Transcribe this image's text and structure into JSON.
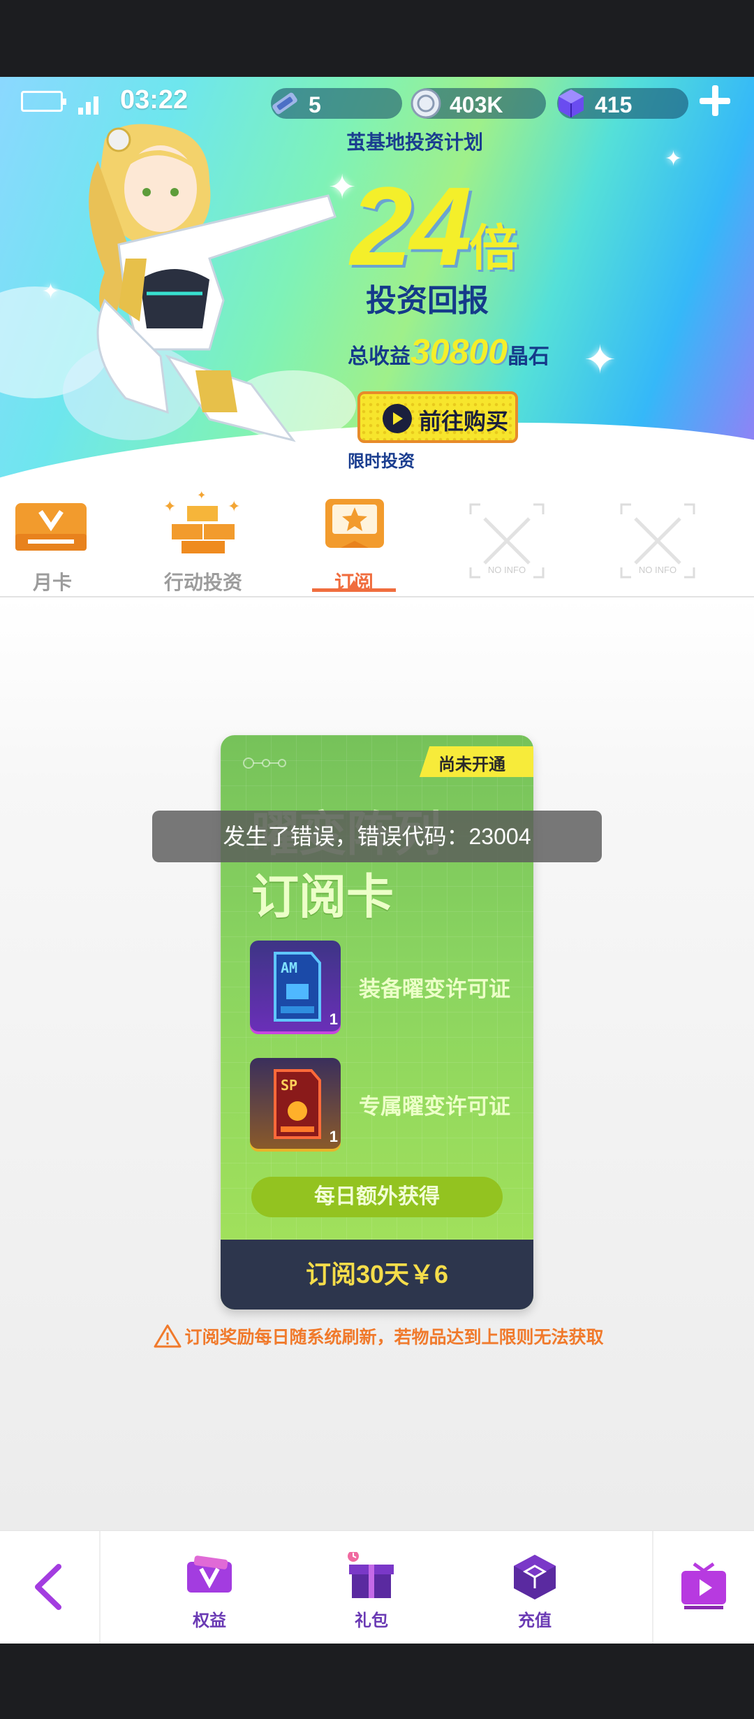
{
  "status_bar": {
    "time": "03:22"
  },
  "currencies": [
    {
      "icon": "ticket-icon",
      "value": "5"
    },
    {
      "icon": "coin-icon",
      "value": "403K"
    },
    {
      "icon": "crystal-cube-icon",
      "value": "415"
    }
  ],
  "banner": {
    "plan_title": "茧基地投资计划",
    "multiplier": "24",
    "multiplier_unit": "倍",
    "return_label": "投资回报",
    "total_label": "总收益",
    "total_value": "30800",
    "total_unit": "晶石",
    "buy_button": "前往购买",
    "limited_label": "限时投资"
  },
  "tabs": [
    {
      "label": "月卡",
      "active": false
    },
    {
      "label": "行动投资",
      "active": false
    },
    {
      "label": "订阅",
      "active": true
    },
    {
      "label": "NO INFO",
      "active": false
    },
    {
      "label": "NO INFO",
      "active": false
    }
  ],
  "card": {
    "ribbon": "尚未开通",
    "title_ghost": "曜变阵列",
    "title": "订阅卡",
    "items": [
      {
        "icon": "am-permit-icon",
        "tag": "AM",
        "count": "1",
        "label": "装备曜变许可证"
      },
      {
        "icon": "sp-permit-icon",
        "tag": "SP",
        "count": "1",
        "label": "专属曜变许可证"
      }
    ],
    "daily_button": "每日额外获得",
    "price_button": "订阅30天￥6"
  },
  "toast": "发生了错误，错误代码：23004",
  "notice": "订阅奖励每日随系统刷新，若物品达到上限则无法获取",
  "bottom_nav": [
    {
      "label": "权益",
      "icon": "v-badge-icon"
    },
    {
      "label": "礼包",
      "icon": "gift-icon"
    },
    {
      "label": "充值",
      "icon": "cube-icon"
    }
  ],
  "colors": {
    "accent_orange": "#f06d3e",
    "nav_purple": "#6a3ab4",
    "price_yellow": "#f5dd4a",
    "card_green": "#8ad460"
  }
}
